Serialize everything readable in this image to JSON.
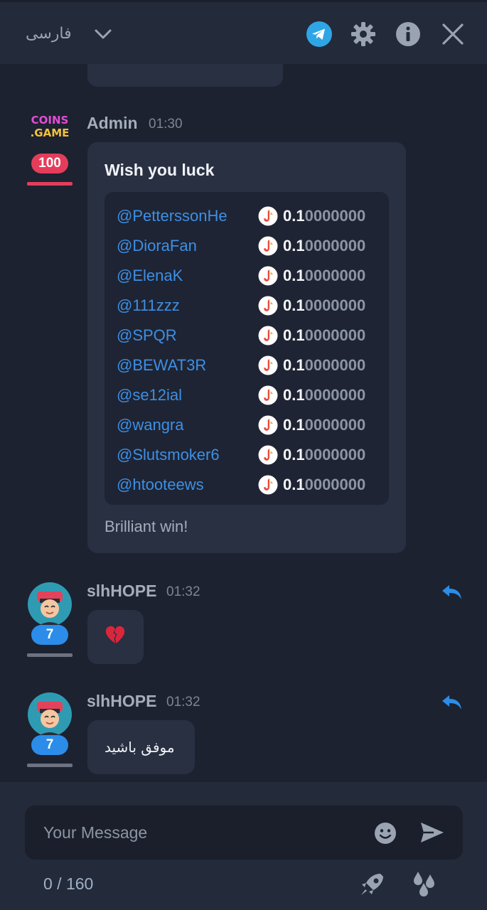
{
  "header": {
    "language": "فارسی",
    "icons": [
      "telegram-icon",
      "gear-icon",
      "info-icon",
      "close-icon"
    ]
  },
  "messages": [
    {
      "author": "Admin",
      "time": "01:30",
      "avatar": {
        "logo_line1": "COINS",
        "logo_line2": ".GAME",
        "level": "100"
      },
      "title": "Wish you luck",
      "rain": [
        {
          "user": "@PetterssonHe",
          "amount_main": "0.1",
          "amount_tail": "0000000"
        },
        {
          "user": "@DioraFan",
          "amount_main": "0.1",
          "amount_tail": "0000000"
        },
        {
          "user": "@ElenaK",
          "amount_main": "0.1",
          "amount_tail": "0000000"
        },
        {
          "user": "@111zzz",
          "amount_main": "0.1",
          "amount_tail": "0000000"
        },
        {
          "user": "@SPQR",
          "amount_main": "0.1",
          "amount_tail": "0000000"
        },
        {
          "user": "@BEWAT3R",
          "amount_main": "0.1",
          "amount_tail": "0000000"
        },
        {
          "user": "@se12ial",
          "amount_main": "0.1",
          "amount_tail": "0000000"
        },
        {
          "user": "@wangra",
          "amount_main": "0.1",
          "amount_tail": "0000000"
        },
        {
          "user": "@Slutsmoker6",
          "amount_main": "0.1",
          "amount_tail": "0000000"
        },
        {
          "user": "@htooteews",
          "amount_main": "0.1",
          "amount_tail": "0000000"
        }
      ],
      "footer": "Brilliant win!"
    },
    {
      "author": "slhHOPE",
      "time": "01:32",
      "avatar": {
        "level": "7"
      },
      "content": "broken-heart-emoji"
    },
    {
      "author": "slhHOPE",
      "time": "01:32",
      "avatar": {
        "level": "7"
      },
      "text": "موفق باشید"
    }
  ],
  "composer": {
    "placeholder": "Your Message",
    "counter": "0 / 160"
  },
  "colors": {
    "background": "#1c2230",
    "panel": "#232a39",
    "bubble": "#283042",
    "link": "#3d8fe6",
    "accent_red": "#e43d5b",
    "accent_blue": "#2b8de9"
  }
}
